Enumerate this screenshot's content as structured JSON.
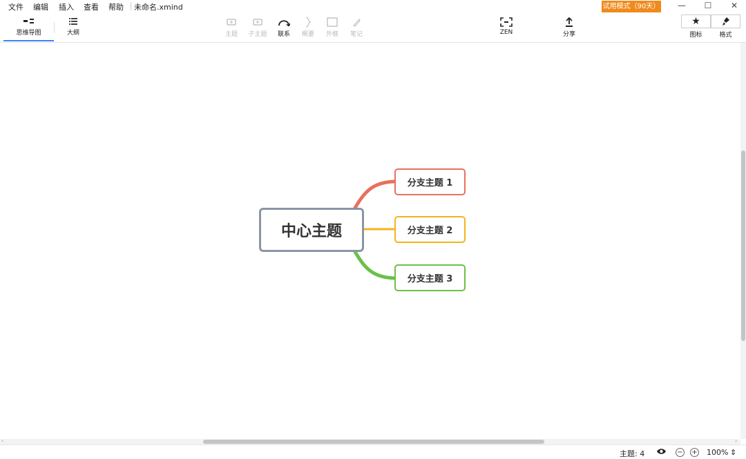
{
  "menu": {
    "items": [
      "文件",
      "编辑",
      "插入",
      "查看",
      "帮助"
    ],
    "document_title": "未命名.xmind"
  },
  "trial_badge": "试用模式（90天）",
  "window_controls": {
    "minimize": "—",
    "maximize": "☐",
    "close": "✕"
  },
  "view_tabs": [
    {
      "label": "思维导图",
      "icon": "mindmap-icon",
      "active": true
    },
    {
      "label": "大纲",
      "icon": "outline-icon",
      "active": false
    }
  ],
  "tools": [
    {
      "label": "主题",
      "icon": "topic-icon",
      "enabled": false
    },
    {
      "label": "子主题",
      "icon": "subtopic-icon",
      "enabled": false
    },
    {
      "label": "联系",
      "icon": "relationship-icon",
      "enabled": true
    },
    {
      "label": "概要",
      "icon": "summary-icon",
      "enabled": false
    },
    {
      "label": "外框",
      "icon": "boundary-icon",
      "enabled": false
    },
    {
      "label": "笔记",
      "icon": "notes-icon",
      "enabled": false
    }
  ],
  "zen": {
    "label": "ZEN",
    "icon": "zen-icon"
  },
  "share": {
    "label": "分享",
    "icon": "share-icon"
  },
  "right_panel": {
    "icons_label": "图标",
    "format_label": "格式"
  },
  "mindmap": {
    "central": "中心主题",
    "branches": [
      {
        "label": "分支主题 1",
        "color": "#e8705f"
      },
      {
        "label": "分支主题 2",
        "color": "#f2b51c"
      },
      {
        "label": "分支主题 3",
        "color": "#6cc04a"
      }
    ],
    "central_border_color": "#8a94a6"
  },
  "status": {
    "topic_count": "主题: 4",
    "zoom": "100%",
    "zoom_out": "−",
    "zoom_in": "+",
    "zoom_stepper": "⇕"
  },
  "colors": {
    "accent": "#3b82f6",
    "trial": "#f08a1c"
  }
}
